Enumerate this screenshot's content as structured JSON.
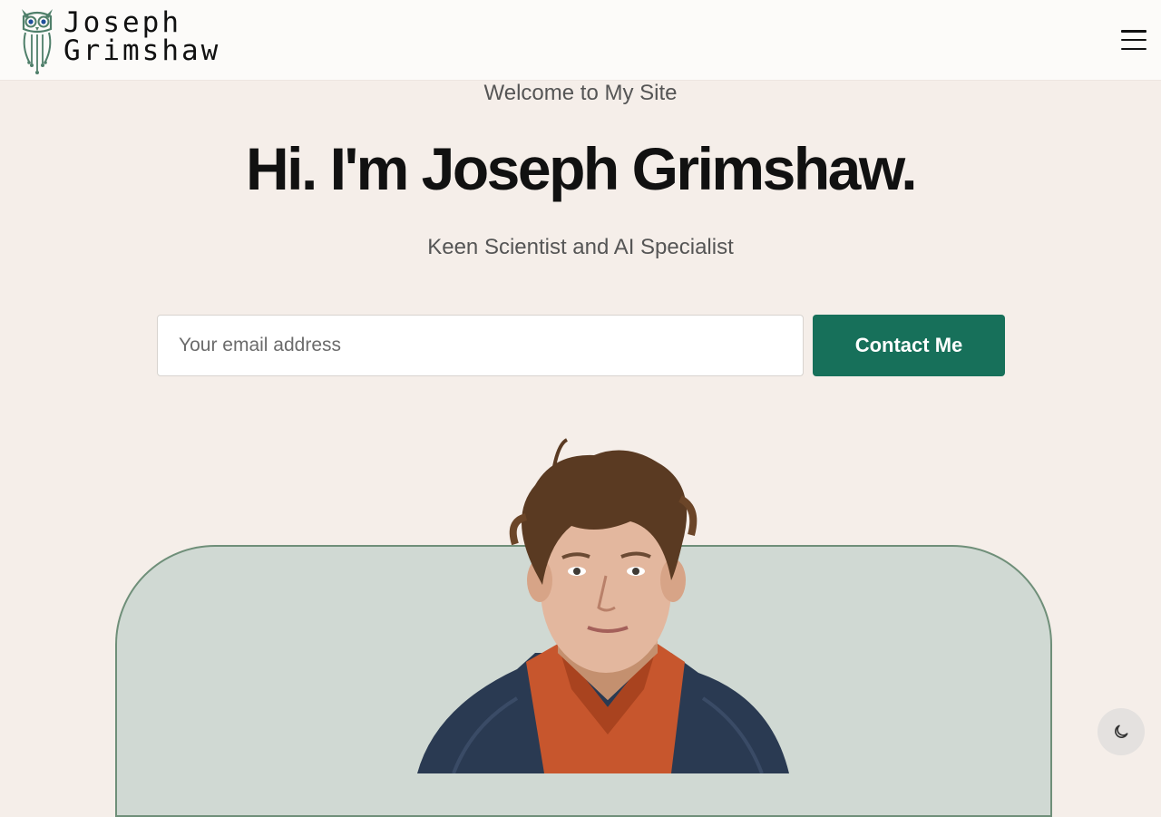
{
  "header": {
    "logo_line1": "Joseph",
    "logo_line2": "Grimshaw",
    "menu_icon": "hamburger-menu-icon"
  },
  "hero": {
    "welcome": "Welcome to My Site",
    "title": "Hi. I'm Joseph Grimshaw.",
    "subtitle": "Keen Scientist and AI Specialist"
  },
  "contact_form": {
    "email_placeholder": "Your email address",
    "button_label": "Contact Me"
  },
  "theme_toggle": {
    "icon": "moon-icon"
  },
  "colors": {
    "accent": "#17705a",
    "page_bg": "#f5eee9",
    "photo_panel": "#d0d9d3"
  }
}
